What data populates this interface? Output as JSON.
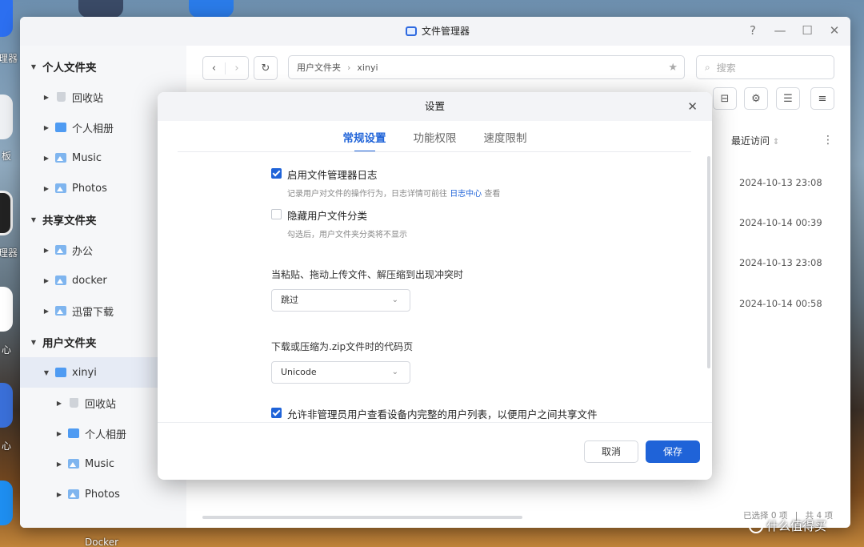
{
  "desktop": {
    "labels": [
      "理器",
      "板",
      "理器",
      "心",
      "心",
      "Docker"
    ]
  },
  "window": {
    "title": "文件管理器",
    "controls": {
      "help": "?",
      "minimize": "—",
      "maximize": "☐",
      "close": "✕"
    }
  },
  "sidebar": {
    "groups": [
      {
        "label": "个人文件夹",
        "items": [
          "回收站",
          "个人相册",
          "Music",
          "Photos"
        ]
      },
      {
        "label": "共享文件夹",
        "items": [
          "办公",
          "docker",
          "迅雷下载"
        ]
      },
      {
        "label": "用户文件夹",
        "items": [
          "xinyi"
        ]
      }
    ],
    "xinyi_children": [
      "回收站",
      "个人相册",
      "Music",
      "Photos"
    ]
  },
  "toolbar": {
    "path": [
      "用户文件夹",
      "xinyi"
    ],
    "search_placeholder": "搜索"
  },
  "list": {
    "column_header": "最近访问",
    "dates": [
      "2024-10-13 23:08",
      "2024-10-14 00:39",
      "2024-10-13 23:08",
      "2024-10-14 00:58"
    ]
  },
  "status": {
    "selected": "已选择 0 项",
    "divider": "|",
    "total": "共 4 项"
  },
  "dialog": {
    "title": "设置",
    "close": "✕",
    "tabs": [
      "常规设置",
      "功能权限",
      "速度限制"
    ],
    "active_tab": 0,
    "options": {
      "enable_log": {
        "label": "启用文件管理器日志",
        "checked": true,
        "desc_before": "记录用户对文件的操作行为，日志详情可前往 ",
        "desc_link": "日志中心",
        "desc_after": " 查看"
      },
      "hide_user_folders": {
        "label": "隐藏用户文件分类",
        "checked": false,
        "desc": "勾选后，用户文件夹分类将不显示"
      },
      "conflict": {
        "label": "当粘贴、拖动上传文件、解压缩到出现冲突时",
        "value": "跳过"
      },
      "codepage": {
        "label": "下载或压缩为.zip文件时的代码页",
        "value": "Unicode"
      },
      "allow_user_list": {
        "label": "允许非管理员用户查看设备内完整的用户列表，以便用户之间共享文件",
        "checked": true
      }
    },
    "buttons": {
      "cancel": "取消",
      "save": "保存"
    }
  },
  "watermark": {
    "text": "什么值得买"
  },
  "colors": {
    "accent": "#1f63d8",
    "folder": "#4f9bf2"
  }
}
